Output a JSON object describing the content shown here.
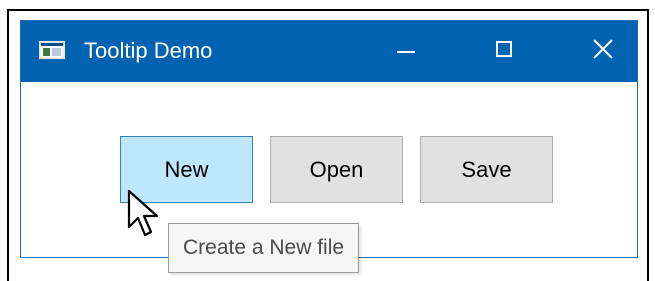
{
  "window": {
    "title": "Tooltip Demo",
    "titlebar_color": "#0063b1",
    "controls": {
      "minimize_icon": "minimize-icon",
      "maximize_icon": "maximize-icon",
      "close_icon": "close-icon"
    }
  },
  "buttons": {
    "new_label": "New",
    "open_label": "Open",
    "save_label": "Save",
    "hover_color": "#bee6fd"
  },
  "tooltip": {
    "text": "Create a New file"
  },
  "cursor": {
    "icon": "arrow-cursor-icon"
  }
}
